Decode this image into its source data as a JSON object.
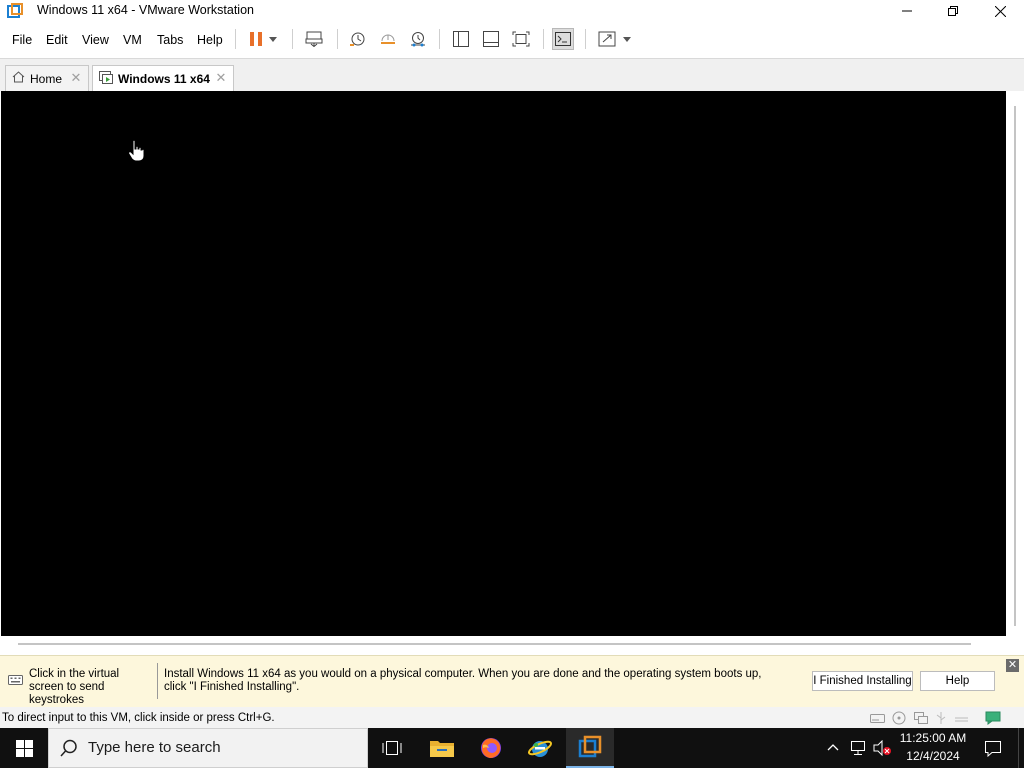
{
  "window": {
    "title": "Windows 11 x64 - VMware Workstation",
    "controls": [
      "minimize",
      "restore",
      "close"
    ]
  },
  "menu": {
    "items": [
      "File",
      "Edit",
      "View",
      "VM",
      "Tabs",
      "Help"
    ]
  },
  "toolbar": {
    "icons": [
      "pause-icon",
      "dropdown-arrow-icon",
      "send-ctrl-alt-del-icon",
      "snapshot-icon",
      "revert-snapshot-icon",
      "snapshot-manager-icon",
      "show-library-icon",
      "thumbnail-bar-icon",
      "full-screen-icon",
      "console-view-icon",
      "stretch-guest-icon",
      "dropdown-arrow-icon"
    ]
  },
  "tabs": [
    {
      "label": "Home",
      "icon": "home-icon",
      "active": false
    },
    {
      "label": "Windows 11 x64",
      "icon": "vm-icon",
      "active": true
    }
  ],
  "hint_bar": {
    "left_text": "Click in the virtual screen to send keystrokes",
    "message": "Install Windows 11 x64 as you would on a physical computer. When you are done and the operating system boots up, click \"I Finished Installing\".",
    "finished_button": "I Finished Installing",
    "help_button": "Help"
  },
  "status_bar": {
    "text": "To direct input to this VM, click inside or press Ctrl+G.",
    "device_icons": [
      "hard-disk-icon",
      "cd-dvd-icon",
      "network-adapter-icon",
      "usb-icon",
      "sound-card-icon",
      "message-log-icon"
    ]
  },
  "taskbar": {
    "search_placeholder": "Type here to search",
    "apps": [
      "task-view",
      "file-explorer",
      "firefox",
      "internet-explorer",
      "vmware-workstation"
    ],
    "clock_time": "11:25:00 AM",
    "clock_date": "12/4/2024"
  },
  "colors": {
    "pause_orange": "#e8702a",
    "hint_bg": "#fdf7dc",
    "taskbar_bg": "#101010",
    "vm_screen": "#000000"
  }
}
